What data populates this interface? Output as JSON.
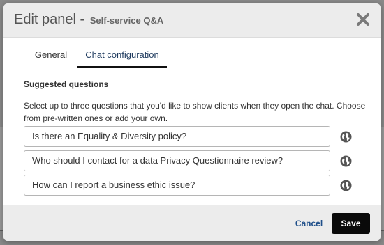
{
  "modal": {
    "title": "Edit panel - ",
    "subtitle": "Self-service Q&A"
  },
  "tabs": [
    {
      "label": "General",
      "active": false
    },
    {
      "label": "Chat configuration",
      "active": true
    }
  ],
  "suggested": {
    "title": "Suggested questions",
    "help": "Select up to three questions that you'd like to show clients when they open the chat. Choose from pre-written ones or add your own.",
    "questions": [
      {
        "value": "Is there an Equality & Diversity policy?",
        "icon": "globe-icon"
      },
      {
        "value": "Who should I contact for a data Privacy Questionnaire review?",
        "icon": "globe-icon"
      },
      {
        "value": "How can I report a business ethic issue?",
        "icon": "globe-icon"
      }
    ]
  },
  "footer": {
    "cancel_label": "Cancel",
    "save_label": "Save"
  },
  "colors": {
    "accent": "#1f4f8a",
    "primary_button": "#0a0a0a",
    "overlay": "#8a8a8a"
  }
}
